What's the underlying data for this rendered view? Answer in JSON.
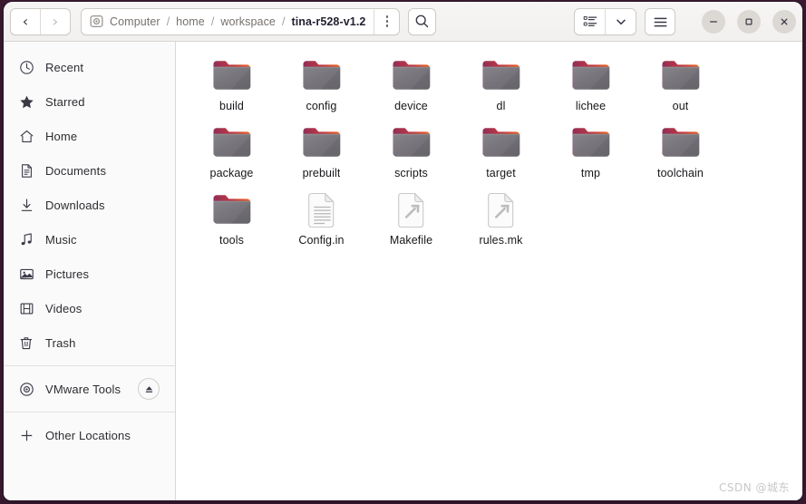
{
  "window": {
    "title": "tina-r528-v1.2",
    "controls": {
      "minimize_label": "–",
      "maximize_label": "□",
      "close_label": "✕"
    }
  },
  "header": {
    "back_label": "‹",
    "forward_label": "›",
    "path_separator": "/",
    "breadcrumbs": [
      {
        "label": "Computer",
        "current": false
      },
      {
        "label": "home",
        "current": false
      },
      {
        "label": "workspace",
        "current": false
      },
      {
        "label": "tina-r528-v1.2",
        "current": true
      }
    ],
    "path_menu_name": "path-options-icon",
    "search_name": "search-icon",
    "view_toggle_name": "list-view-icon",
    "view_dropdown_name": "chevron-down-icon",
    "main_menu_name": "hamburger-menu-icon"
  },
  "sidebar": {
    "items": [
      {
        "label": "Recent",
        "icon": "clock-icon",
        "eject": false
      },
      {
        "label": "Starred",
        "icon": "star-icon",
        "eject": false
      },
      {
        "label": "Home",
        "icon": "home-icon",
        "eject": false
      },
      {
        "label": "Documents",
        "icon": "document-icon",
        "eject": false
      },
      {
        "label": "Downloads",
        "icon": "download-icon",
        "eject": false
      },
      {
        "label": "Music",
        "icon": "music-icon",
        "eject": false
      },
      {
        "label": "Pictures",
        "icon": "picture-icon",
        "eject": false
      },
      {
        "label": "Videos",
        "icon": "video-icon",
        "eject": false
      },
      {
        "label": "Trash",
        "icon": "trash-icon",
        "eject": false
      },
      {
        "label": "VMware Tools",
        "icon": "disc-icon",
        "eject": true
      },
      {
        "label": "Other Locations",
        "icon": "plus-icon",
        "eject": false
      }
    ],
    "separator_after": [
      8,
      9
    ],
    "eject_name": "eject-icon"
  },
  "content": {
    "items": [
      {
        "name": "build",
        "type": "folder"
      },
      {
        "name": "config",
        "type": "folder"
      },
      {
        "name": "device",
        "type": "folder"
      },
      {
        "name": "dl",
        "type": "folder"
      },
      {
        "name": "lichee",
        "type": "folder"
      },
      {
        "name": "out",
        "type": "folder"
      },
      {
        "name": "package",
        "type": "folder"
      },
      {
        "name": "prebuilt",
        "type": "folder"
      },
      {
        "name": "scripts",
        "type": "folder"
      },
      {
        "name": "target",
        "type": "folder"
      },
      {
        "name": "tmp",
        "type": "folder"
      },
      {
        "name": "toolchain",
        "type": "folder"
      },
      {
        "name": "tools",
        "type": "folder"
      },
      {
        "name": "Config.in",
        "type": "text-file"
      },
      {
        "name": "Makefile",
        "type": "makefile"
      },
      {
        "name": "rules.mk",
        "type": "makefile"
      }
    ]
  },
  "watermark": {
    "text": "CSDN @城东"
  },
  "colors": {
    "folder_tab_start": "#8e2d5a",
    "folder_tab_end": "#f26522",
    "folder_body": "#77767b",
    "sidebar_bg": "#fafafa",
    "content_bg": "#ffffff",
    "headerbar_bg": "#f6f5f4",
    "desktop_bg": "#3b1b32"
  }
}
